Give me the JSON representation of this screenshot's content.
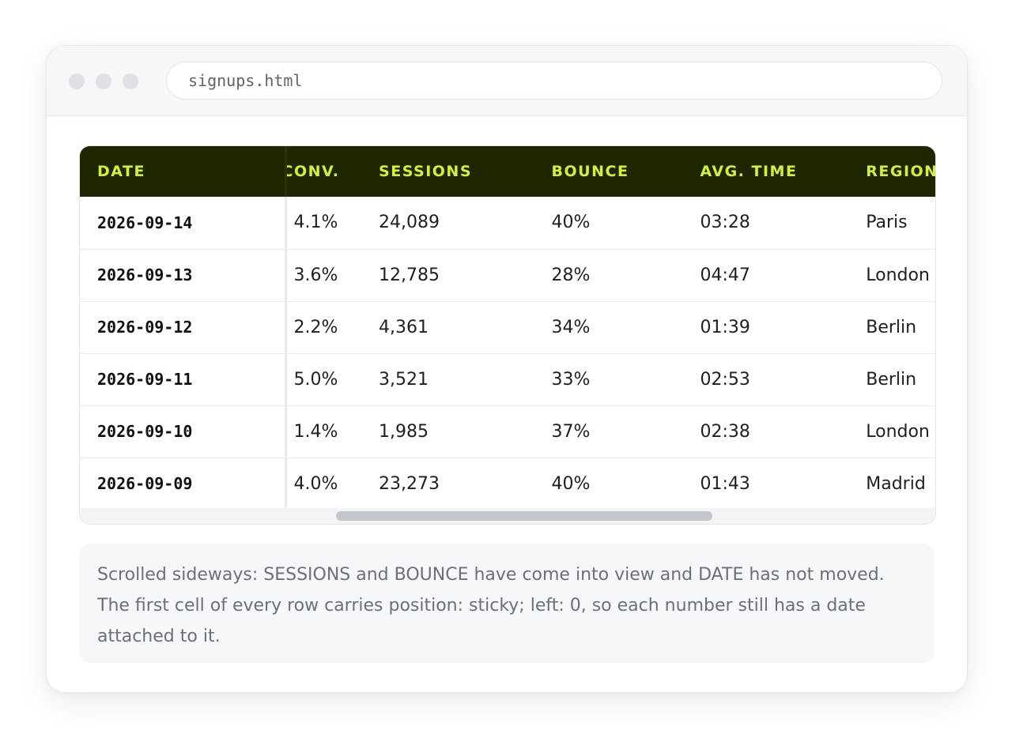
{
  "window": {
    "address": "signups.html"
  },
  "table": {
    "columns": [
      "DATE",
      "CONV.",
      "SESSIONS",
      "BOUNCE",
      "AVG. TIME",
      "REGION"
    ],
    "rows": [
      [
        "2026-09-14",
        "4.1%",
        "24,089",
        "40%",
        "03:28",
        "Paris"
      ],
      [
        "2026-09-13",
        "3.6%",
        "12,785",
        "28%",
        "04:47",
        "London"
      ],
      [
        "2026-09-12",
        "2.2%",
        "4,361",
        "34%",
        "01:39",
        "Berlin"
      ],
      [
        "2026-09-11",
        "5.0%",
        "3,521",
        "33%",
        "02:53",
        "Berlin"
      ],
      [
        "2026-09-10",
        "1.4%",
        "1,985",
        "37%",
        "02:38",
        "London"
      ],
      [
        "2026-09-09",
        "4.0%",
        "23,273",
        "40%",
        "01:43",
        "Madrid"
      ]
    ]
  },
  "note": {
    "text": "Scrolled sideways: SESSIONS and BOUNCE have come into view and DATE has not moved. The first cell of every row carries position: sticky; left: 0, so each number still has a date attached to it."
  },
  "colors": {
    "header_bg": "#1f2700",
    "header_text": "#d4f235"
  }
}
